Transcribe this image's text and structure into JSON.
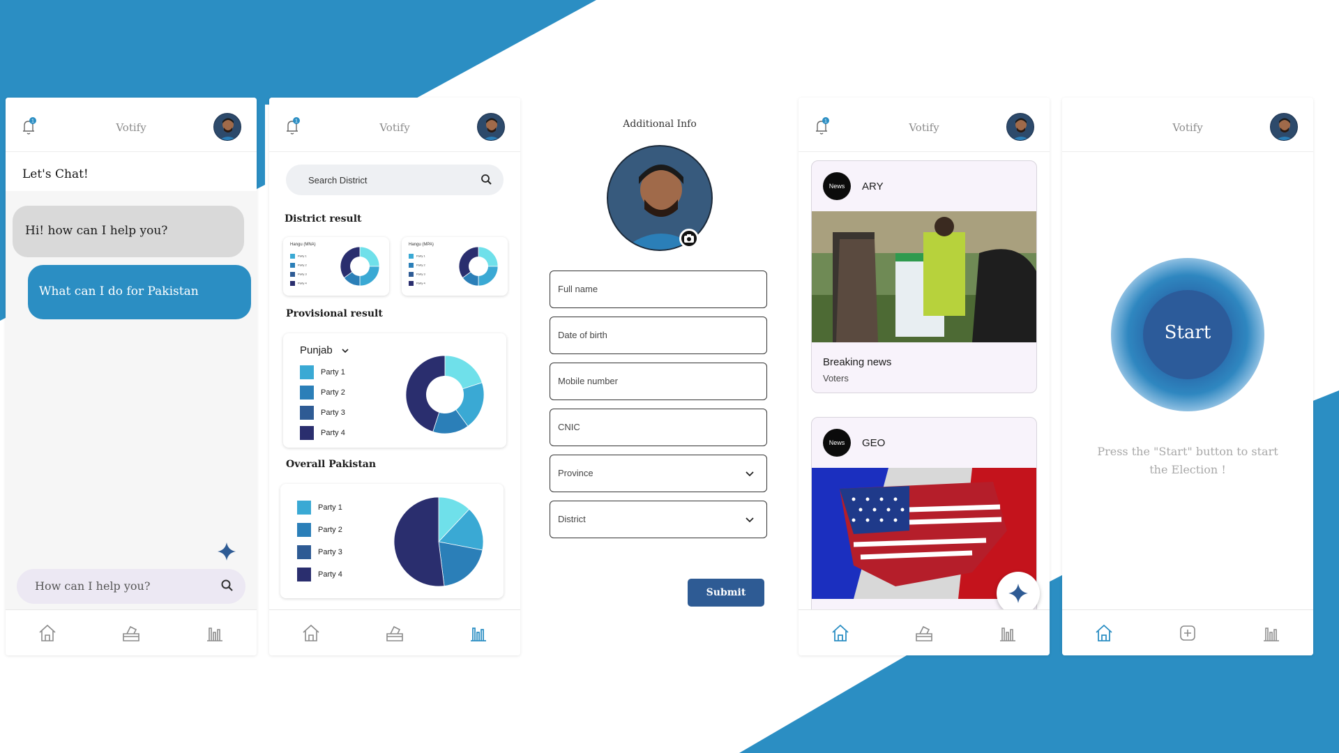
{
  "brand": {
    "primary": "#2b8ec3",
    "dark": "#2e5b94",
    "navy": "#2a2e6e"
  },
  "app_title": "Votify",
  "chat_screen": {
    "heading": "Let's Chat!",
    "bot_message": "Hi! how can I help you?",
    "user_message": "What can I do for Pakistan",
    "input_placeholder": "How can I help you?"
  },
  "results_screen": {
    "search_placeholder": "Search District",
    "district_heading": "District result",
    "district_cards": [
      {
        "label": "Hangu (MNA)",
        "legend": [
          "Party 1",
          "Party 2",
          "Party 3",
          "Party 4"
        ]
      },
      {
        "label": "Hangu (MPA)",
        "legend": [
          "Party 1",
          "Party 2",
          "Party 3",
          "Party 4"
        ]
      }
    ],
    "provisional_heading": "Provisional result",
    "province_select": "Punjab",
    "provisional_legend": [
      "Party 1",
      "Party 2",
      "Party 3",
      "Party 4"
    ],
    "overall_heading": "Overall Pakistan",
    "overall_legend": [
      "Party 1",
      "Party 2",
      "Party 3",
      "Party 4"
    ]
  },
  "form_screen": {
    "title": "Additional Info",
    "fields": {
      "full_name": "Full name",
      "dob": "Date of birth",
      "mobile": "Mobile number",
      "cnic": "CNIC",
      "province": "Province",
      "district": "District"
    },
    "submit": "Submit"
  },
  "news_screen": {
    "cards": [
      {
        "logo": "News",
        "source": "ARY",
        "headline": "Breaking news",
        "sub": "Voters"
      },
      {
        "logo": "News",
        "source": "GEO"
      }
    ]
  },
  "start_screen": {
    "button": "Start",
    "hint": "Press the \"Start\" button to start the Election !"
  },
  "icons": [
    "bell-icon",
    "home-icon",
    "ballot-box-icon",
    "bar-chart-icon",
    "plus-square-icon",
    "search-icon",
    "sparkle-icon",
    "camera-icon",
    "chevron-down-icon"
  ],
  "chart_data": [
    {
      "type": "pie",
      "title": "Hangu (MNA)",
      "categories": [
        "Party 1",
        "Party 2",
        "Party 3",
        "Party 4"
      ],
      "values": [
        25,
        25,
        15,
        35
      ],
      "donut": true
    },
    {
      "type": "pie",
      "title": "Hangu (MPA)",
      "categories": [
        "Party 1",
        "Party 2",
        "Party 3",
        "Party 4"
      ],
      "values": [
        25,
        25,
        15,
        35
      ],
      "donut": true
    },
    {
      "type": "pie",
      "title": "Provisional result",
      "categories": [
        "Party 1",
        "Party 2",
        "Party 3",
        "Party 4"
      ],
      "values": [
        20,
        20,
        15,
        45
      ],
      "donut": true
    },
    {
      "type": "pie",
      "title": "Overall Pakistan",
      "categories": [
        "Party 1",
        "Party 2",
        "Party 3",
        "Party 4"
      ],
      "values": [
        12,
        16,
        20,
        52
      ],
      "donut": false
    }
  ],
  "palette": [
    "#6fe0ea",
    "#3aa9d4",
    "#2b7fb8",
    "#2a2e6e"
  ]
}
